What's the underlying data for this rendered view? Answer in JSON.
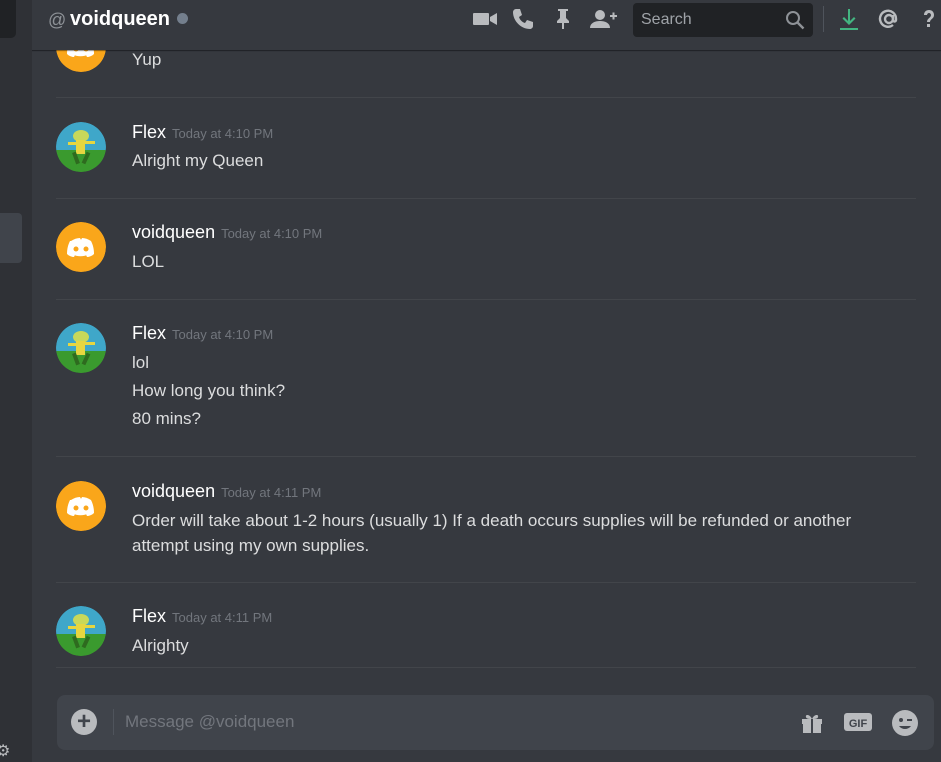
{
  "header": {
    "at_symbol": "@",
    "username": "voidqueen",
    "search_placeholder": "Search",
    "icons": [
      "video-camera-icon",
      "phone-icon",
      "pin-icon",
      "add-friend-icon",
      "download-icon",
      "mention-icon",
      "help-icon"
    ]
  },
  "messages": [
    {
      "author": "",
      "time": "",
      "lines": [
        "Yup"
      ]
    },
    {
      "author": "Flex",
      "time": "Today at 4:10 PM",
      "lines": [
        "Alright my Queen"
      ]
    },
    {
      "author": "voidqueen",
      "time": "Today at 4:10 PM",
      "lines": [
        "LOL"
      ]
    },
    {
      "author": "Flex",
      "time": "Today at 4:10 PM",
      "lines": [
        "lol",
        "How long you think?",
        "80 mins?"
      ]
    },
    {
      "author": "voidqueen",
      "time": "Today at 4:11 PM",
      "lines": [
        "Order will take about 1-2 hours (usually 1) If a death occurs supplies will be refunded or another",
        "attempt using my own supplies."
      ]
    },
    {
      "author": "Flex",
      "time": "Today at 4:11 PM",
      "lines": [
        "Alrighty"
      ]
    }
  ],
  "composer": {
    "placeholder": "Message @voidqueen",
    "gif_label": "GIF"
  },
  "colors": {
    "discord_avatar": "#faa61a",
    "background": "#36393f",
    "download_accent": "#43b581"
  }
}
